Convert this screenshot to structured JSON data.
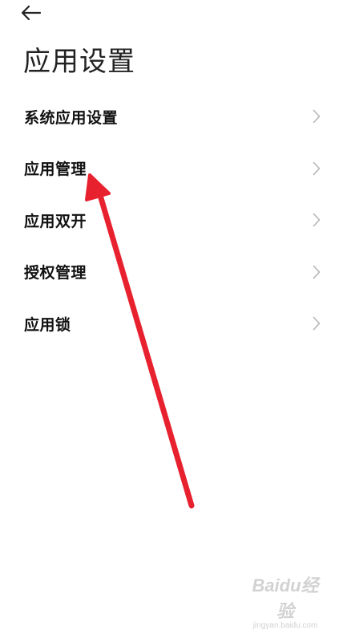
{
  "header": {
    "back_icon": "arrow-left-icon",
    "title": "应用设置"
  },
  "settings": {
    "items": [
      {
        "label": "系统应用设置",
        "icon": "chevron-right-icon"
      },
      {
        "label": "应用管理",
        "icon": "chevron-right-icon"
      },
      {
        "label": "应用双开",
        "icon": "chevron-right-icon"
      },
      {
        "label": "授权管理",
        "icon": "chevron-right-icon"
      },
      {
        "label": "应用锁",
        "icon": "chevron-right-icon"
      }
    ]
  },
  "annotation": {
    "type": "red-arrow",
    "color": "#e8212f",
    "points_to": "应用管理"
  },
  "watermark": {
    "brand": "Baidu经验",
    "url": "jingyan.baidu.com"
  },
  "colors": {
    "background": "#ffffff",
    "text": "#111111",
    "chevron": "#b5b5b5",
    "arrow": "#e8212f"
  }
}
